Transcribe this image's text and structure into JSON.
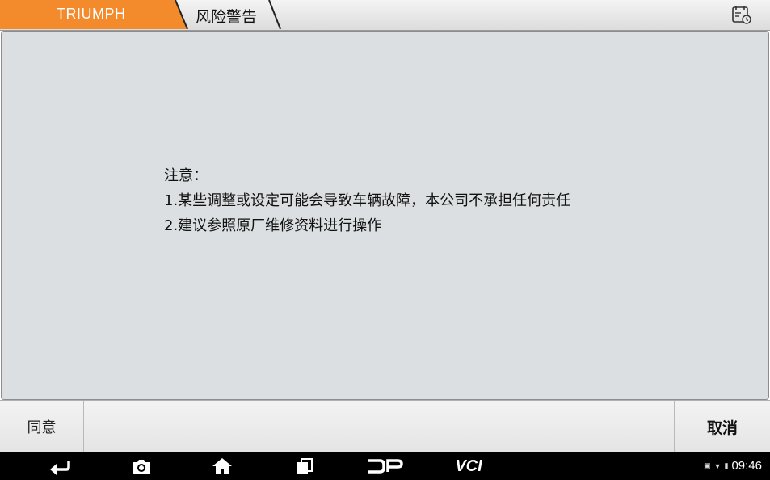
{
  "header": {
    "brand_tab": "TRIUMPH",
    "page_tab": "风险警告",
    "brand_color": "#f38a2c"
  },
  "notice": {
    "title": "注意：",
    "lines": [
      "1.某些调整或设定可能会导致车辆故障，本公司不承担任何责任",
      "2.建议参照原厂维修资料进行操作"
    ]
  },
  "actions": {
    "agree": "同意",
    "cancel": "取消"
  },
  "navbar": {
    "buttons": [
      "back-icon",
      "camera-icon",
      "home-icon",
      "recent-apps-icon",
      "dp-icon",
      "vci-icon"
    ],
    "vci_label": "VCI",
    "dp_label": "DP",
    "time": "09:46"
  }
}
